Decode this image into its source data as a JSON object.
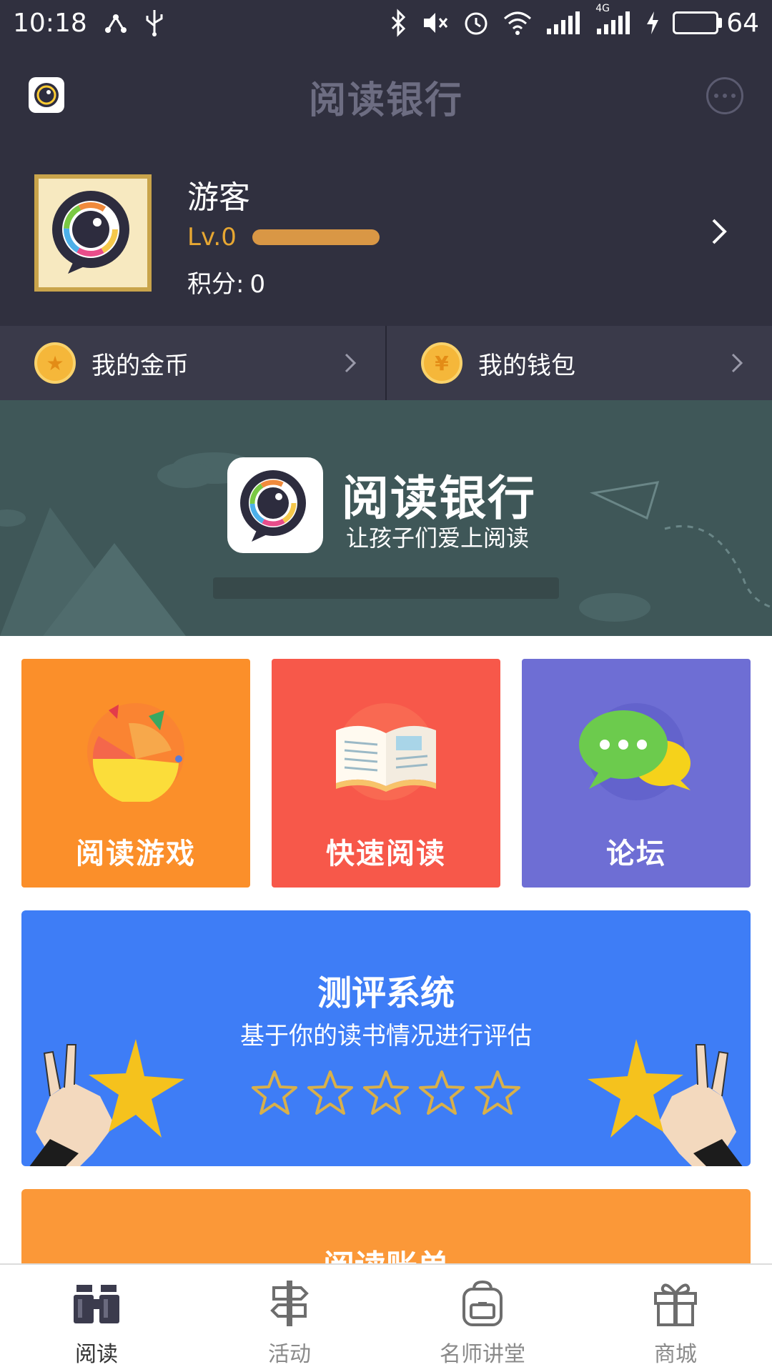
{
  "status_bar": {
    "time": "10:18",
    "network_type": "4G",
    "battery": "64",
    "battery_level": 0.64
  },
  "header": {
    "title": "阅读银行"
  },
  "profile": {
    "name": "游客",
    "level": "Lv.0",
    "points_label": "积分:",
    "points_value": "0"
  },
  "wallet": {
    "coins_label": "我的金币",
    "wallet_label": "我的钱包",
    "wallet_symbol": "¥"
  },
  "banner": {
    "title": "阅读银行",
    "subtitle": "让孩子们爱上阅读"
  },
  "tiles": [
    {
      "label": "阅读游戏",
      "color": "#fb8f2a"
    },
    {
      "label": "快速阅读",
      "color": "#f7584a"
    },
    {
      "label": "论坛",
      "color": "#6e6ed4"
    }
  ],
  "evaluation": {
    "title": "测评系统",
    "subtitle": "基于你的读书情况进行评估",
    "stars_count": 5,
    "color": "#3e7df6"
  },
  "bill": {
    "title": "阅读账单",
    "color": "#fb9838"
  },
  "tabs": [
    {
      "label": "阅读",
      "icon": "binoculars-icon",
      "active": true
    },
    {
      "label": "活动",
      "icon": "signpost-icon",
      "active": false
    },
    {
      "label": "名师讲堂",
      "icon": "backpack-icon",
      "active": false
    },
    {
      "label": "商城",
      "icon": "gift-icon",
      "active": false
    }
  ]
}
